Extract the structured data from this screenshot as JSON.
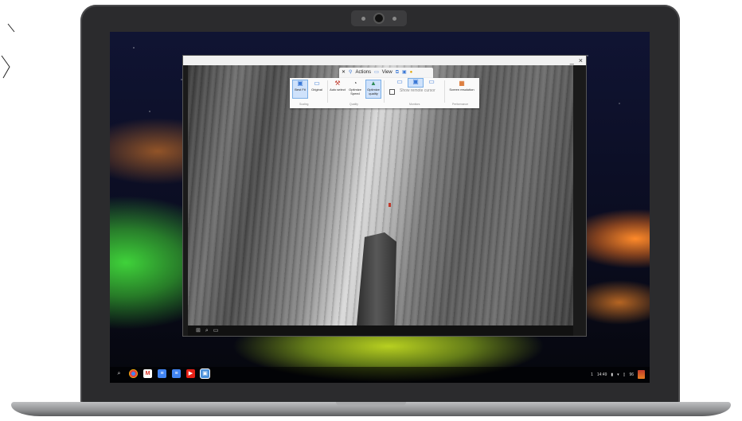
{
  "toolbar": {
    "actions_label": "Actions",
    "view_label": "View",
    "close_symbol": "✕",
    "expand_symbol": "⤢"
  },
  "window": {
    "minimize_symbol": "_",
    "close_symbol": "×"
  },
  "ribbon": {
    "buttons": [
      {
        "label": "Best Fit",
        "icon": "monitor-icon"
      },
      {
        "label": "Original",
        "icon": "monitor-icon"
      },
      {
        "label": "Auto select",
        "icon": "wrench-icon"
      },
      {
        "label": "Optimize Speed",
        "icon": "gauge-icon"
      },
      {
        "label": "Optimize quality",
        "icon": "image-icon"
      },
      {
        "label": "",
        "icon": "monitor-single-icon"
      },
      {
        "label": "",
        "icon": "monitor-dual-icon"
      },
      {
        "label": "",
        "icon": "monitor-swap-icon"
      },
      {
        "label": "Screen resolution",
        "icon": "resolution-icon"
      }
    ],
    "show_cursor_label": "Show remote cursor",
    "groups": [
      "Scaling",
      "Quality",
      "Monitors",
      "Performance"
    ]
  },
  "remote_taskbar": {
    "icons": [
      "windows-icon",
      "search-icon",
      "task-view-icon"
    ]
  },
  "shelf": {
    "apps": [
      {
        "icon": "launcher-icon",
        "color": "#333333"
      },
      {
        "icon": "chrome-icon",
        "color": "#e8453c"
      },
      {
        "icon": "gmail-icon",
        "color": "#d93025"
      },
      {
        "icon": "docs-icon",
        "color": "#4285f4"
      },
      {
        "icon": "docs-icon",
        "color": "#4285f4"
      },
      {
        "icon": "youtube-icon",
        "color": "#e62117"
      },
      {
        "icon": "remote-desktop-icon",
        "color": "#4a90d9"
      }
    ],
    "status": {
      "notification": "1",
      "time": "14:49",
      "battery": "96"
    }
  }
}
